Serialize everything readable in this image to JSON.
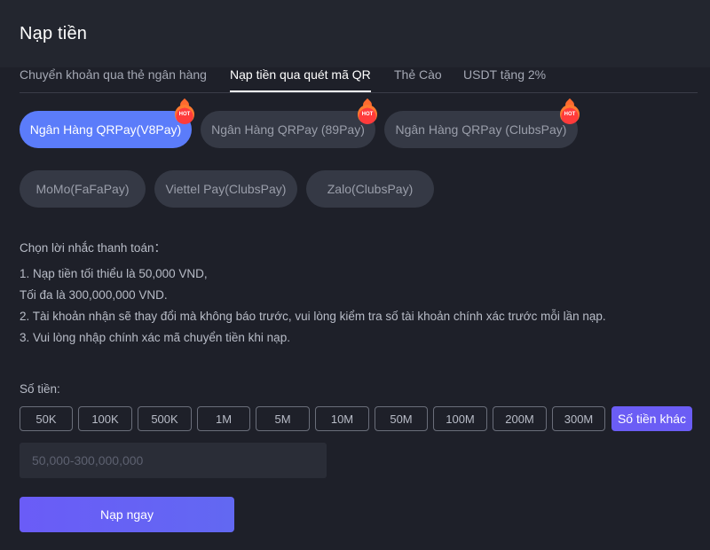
{
  "header": {
    "title": "Nạp tiền"
  },
  "tabs": [
    {
      "label": "Chuyển khoản qua thẻ ngân hàng"
    },
    {
      "label": "Nạp tiền qua quét mã QR"
    },
    {
      "label": "Thẻ Cào"
    },
    {
      "label": "USDT tặng 2%"
    }
  ],
  "payment_methods": [
    {
      "label": "Ngân Hàng QRPay(V8Pay)",
      "badge": "HOT",
      "selected": true
    },
    {
      "label": "Ngân Hàng QRPay (89Pay)",
      "badge": "HOT"
    },
    {
      "label": "Ngân Hàng QRPay (ClubsPay)",
      "badge": "HOT"
    },
    {
      "label": "MoMo(FaFaPay)"
    },
    {
      "label": "Viettel Pay(ClubsPay)"
    },
    {
      "label": "Zalo(ClubsPay)"
    }
  ],
  "notes": {
    "heading": "Chọn lời nhắc thanh toán：",
    "lines": [
      "1. Nạp tiền tối thiểu là 50,000 VND,",
      "Tối đa là 300,000,000 VND.",
      "2. Tài khoản nhận sẽ thay đổi mà không báo trước, vui lòng kiểm tra số tài khoản chính xác trước mỗi lần nạp.",
      "3. Vui lòng nhập chính xác mã chuyển tiền khi nạp."
    ]
  },
  "amount": {
    "label": "Số tiền:",
    "options": [
      "50K",
      "100K",
      "500K",
      "1M",
      "5M",
      "10M",
      "50M",
      "100M",
      "200M",
      "300M"
    ],
    "other_label": "Số tiền khác",
    "input_placeholder": "50,000-300,000,000",
    "input_value": ""
  },
  "submit_label": "Nạp ngay",
  "colors": {
    "background": "#1e2029",
    "header": "#23262f",
    "active_method": "#5b7cfa",
    "accent": "#6b5df5",
    "hot_badge": "#ff3b3b"
  }
}
